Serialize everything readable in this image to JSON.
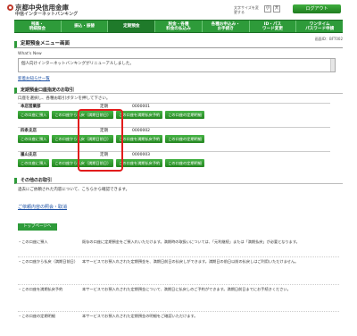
{
  "header": {
    "bank_name": "京都中央信用金庫",
    "bank_sub": "中信インターネットバンキング",
    "fontsize_label": "文字サイズを変更する",
    "fs_small": "小",
    "fs_large": "大",
    "logout_label": "ログアウト"
  },
  "nav": {
    "items": [
      {
        "label": "残高・\n明細照会"
      },
      {
        "label": "振込・振替"
      },
      {
        "label": "定期預金"
      },
      {
        "label": "税金・各種\n料金の払込み"
      },
      {
        "label": "各種お申込み・\nお手続き"
      },
      {
        "label": "ID・パス\nワード変更"
      },
      {
        "label": "ワンタイム\nパスワード申請"
      }
    ]
  },
  "screen_id": "画面ID：BFT002",
  "page_title": "定期預金メニュー画面",
  "whatsnew": {
    "label": "What's New",
    "message": "個人向けインターネットバンキングがリニューアルしました。",
    "link": "新着お知らせ一覧"
  },
  "deposit_section": {
    "title": "定期預金口座指定のお取引",
    "desc": "口座を選択し、各種お取引ボタンを押して下さい。",
    "accounts": [
      {
        "branch": "本店営業部",
        "type": "定期",
        "number": "0000001",
        "buttons": [
          "この口座に預入",
          "この口座から払戻（満期日前日）",
          "この口座を満期払戻予約",
          "この口座の定期明細"
        ]
      },
      {
        "branch": "四条支店",
        "type": "定期",
        "number": "0000002",
        "buttons": [
          "この口座に預入",
          "この口座から払戻（満期日前日）",
          "この口座を満期払戻予約",
          "この口座の定期明細"
        ]
      },
      {
        "branch": "嵐山支店",
        "type": "定期",
        "number": "0000003",
        "buttons": [
          "この口座に預入",
          "この口座から払戻（満期日前日）",
          "この口座を満期払戻予約",
          "この口座の定期明細"
        ]
      }
    ]
  },
  "other_section": {
    "title": "その他のお取引",
    "desc": "過去にご依頼された内容について、こちらから確認できます。",
    "link": "ご依頼内容の照会・取消",
    "top_button": "トップページへ"
  },
  "help": [
    {
      "term": "・この口座に預入",
      "def": "既存の口座に定期預金をご預入れいただけます。満期時の取扱いについては、「元利継続」または「満期払戻」が必要となります。"
    },
    {
      "term": "・この口座から払戻（満期日前日）",
      "def": "本サービスでお預入れされた定期預金を、満期日前日の払戻しができます。満期日の前日以前の払戻しはご利用いただけません。"
    },
    {
      "term": "・この口座を満期払戻予約",
      "def": "本サービスでお預入れされた定期預金について、満期日に払戻しのご予約ができます。満期日前日までにお手続きください。"
    },
    {
      "term": "・この口座の定期明細",
      "def": "本サービスでお預入れされた定期預金の明細をご確認いただけます。"
    }
  ]
}
